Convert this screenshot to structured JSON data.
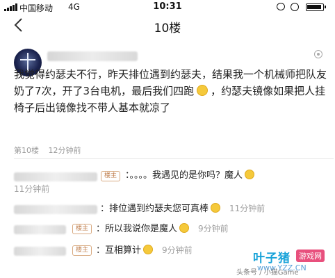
{
  "status_bar": {
    "carrier": "中国移动",
    "network": "4G",
    "time": "10:31"
  },
  "nav": {
    "title": "10楼"
  },
  "post": {
    "text_before_emoji": "我觉得约瑟夫不行，昨天排位遇到约瑟夫，结果我一个机械师把队友奶了7次，开了3台电机，最后我们四跑",
    "text_after_emoji": "，约瑟夫镜像如果把人挂椅子后出镜像找不带人基本就凉了",
    "floor": "第10楼",
    "time": "12分钟前"
  },
  "replies": [
    {
      "badge": "楼主",
      "text": "：。。。。我遇见的是你吗？魔人",
      "time": "11分钟前"
    },
    {
      "text": "：排位遇到约瑟夫您可真棒",
      "time": "11分钟前"
    },
    {
      "badge": "楼主",
      "text": "：所以我说你是魔人",
      "time": "9分钟前"
    },
    {
      "badge": "楼主",
      "text": "：互相算计",
      "time": "9分钟前"
    }
  ],
  "watermark": {
    "brand": "叶子猪",
    "game_tag": "游戏网",
    "site": "www.YZZ.CN",
    "source": "头条号 / 小猫Game"
  },
  "icons": {
    "back": "chevron-left-icon",
    "more": "more-options-icon",
    "emoji": "smiley-emoji-icon"
  },
  "colors": {
    "badge_border": "#d8a980",
    "meta_text": "#9a9a9a",
    "brand_blue": "#19a3d9",
    "brand_pink": "#e8507d"
  }
}
